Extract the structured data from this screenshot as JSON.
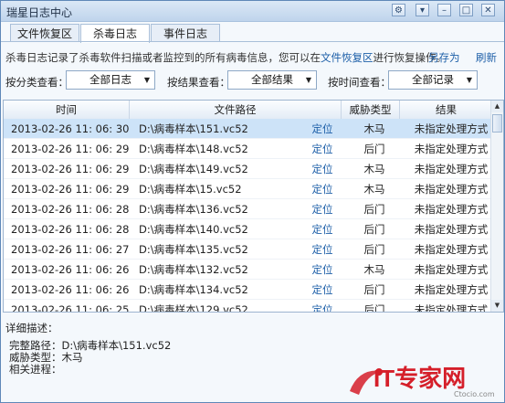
{
  "window": {
    "title": "瑞星日志中心"
  },
  "title_controls": [
    "gear-icon",
    "dropdown-icon",
    "minimize-icon",
    "maximize-icon",
    "close-icon"
  ],
  "tabs": [
    {
      "label": "文件恢复区"
    },
    {
      "label": "杀毒日志",
      "active": true
    },
    {
      "label": "事件日志"
    }
  ],
  "info": {
    "prefix": "杀毒日志记录了杀毒软件扫描或者监控到的所有病毒信息，您可以在",
    "link": "文件恢复区",
    "suffix": "进行恢复操作。",
    "save_as": "另存为",
    "refresh": "刷新"
  },
  "filters": {
    "by_category_label": "按分类查看：",
    "by_category_value": "全部日志",
    "by_result_label": "按结果查看：",
    "by_result_value": "全部结果",
    "by_time_label": "按时间查看：",
    "by_time_value": "全部记录"
  },
  "table": {
    "headers": {
      "time": "时间",
      "path": "文件路径",
      "type": "威胁类型",
      "result": "结果"
    },
    "rows": [
      {
        "time": "2013-02-26 11: 06: 30",
        "path": "D:\\病毒样本\\151.vc52",
        "locate": "定位",
        "type": "木马",
        "result": "未指定处理方式",
        "selected": true
      },
      {
        "time": "2013-02-26 11: 06: 29",
        "path": "D:\\病毒样本\\148.vc52",
        "locate": "定位",
        "type": "后门",
        "result": "未指定处理方式"
      },
      {
        "time": "2013-02-26 11: 06: 29",
        "path": "D:\\病毒样本\\149.vc52",
        "locate": "定位",
        "type": "木马",
        "result": "未指定处理方式"
      },
      {
        "time": "2013-02-26 11: 06: 29",
        "path": "D:\\病毒样本\\15.vc52",
        "locate": "定位",
        "type": "木马",
        "result": "未指定处理方式"
      },
      {
        "time": "2013-02-26 11: 06: 28",
        "path": "D:\\病毒样本\\136.vc52",
        "locate": "定位",
        "type": "后门",
        "result": "未指定处理方式"
      },
      {
        "time": "2013-02-26 11: 06: 28",
        "path": "D:\\病毒样本\\140.vc52",
        "locate": "定位",
        "type": "后门",
        "result": "未指定处理方式"
      },
      {
        "time": "2013-02-26 11: 06: 27",
        "path": "D:\\病毒样本\\135.vc52",
        "locate": "定位",
        "type": "后门",
        "result": "未指定处理方式"
      },
      {
        "time": "2013-02-26 11: 06: 26",
        "path": "D:\\病毒样本\\132.vc52",
        "locate": "定位",
        "type": "木马",
        "result": "未指定处理方式"
      },
      {
        "time": "2013-02-26 11: 06: 26",
        "path": "D:\\病毒样本\\134.vc52",
        "locate": "定位",
        "type": "后门",
        "result": "未指定处理方式"
      },
      {
        "time": "2013-02-26 11: 06: 25",
        "path": "D:\\病毒样本\\129.vc52",
        "locate": "定位",
        "type": "后门",
        "result": "未指定处理方式"
      }
    ]
  },
  "detail": {
    "title": "详细描述：",
    "full_path": "完整路径：D:\\病毒样本\\151.vc52",
    "threat_type": "威胁类型：木马",
    "process": "相关进程："
  },
  "watermark": {
    "brand": "IT专家网",
    "site": "Ctocio.com"
  },
  "colors": {
    "accent": "#1d5fa8",
    "selected_row": "#cde3f8",
    "watermark": "#d51f2a"
  }
}
